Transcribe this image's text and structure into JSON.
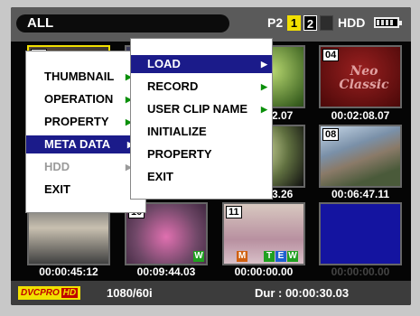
{
  "top_bar": {
    "selection": "ALL",
    "card_label": "P2",
    "slots": [
      "1",
      "2",
      ""
    ],
    "hdd_label": "HDD",
    "battery_level": 0.8
  },
  "clips": [
    {
      "number": "01",
      "timecode": ""
    },
    {
      "number": "",
      "timecode": ""
    },
    {
      "number": "",
      "timecode": "00:00:12.07"
    },
    {
      "number": "04",
      "timecode": "00:02:08.07",
      "thumb_text": "Neo Classic"
    },
    {
      "number": "",
      "timecode": ""
    },
    {
      "number": "",
      "timecode": ""
    },
    {
      "number": "",
      "timecode": "00:00:13.26"
    },
    {
      "number": "08",
      "timecode": "00:06:47.11"
    },
    {
      "number": "",
      "timecode": "00:00:45:12"
    },
    {
      "number": "10",
      "timecode": "00:09:44.03",
      "badges": [
        "W"
      ]
    },
    {
      "number": "11",
      "timecode": "00:00:00.00",
      "badges": [
        "M",
        "T",
        "E",
        "W"
      ]
    },
    {
      "number": "",
      "timecode": "00:00:00.00"
    }
  ],
  "bottom_bar": {
    "codec_part1": "DVCPRO",
    "codec_part2": "HD",
    "format": "1080/60i",
    "duration": "Dur : 00:00:30.03"
  },
  "main_menu": {
    "items": [
      {
        "label": "THUMBNAIL",
        "arrow": "▶"
      },
      {
        "label": "OPERATION",
        "arrow": "▶"
      },
      {
        "label": "PROPERTY",
        "arrow": "▶"
      },
      {
        "label": "META DATA",
        "arrow": "▶"
      },
      {
        "label": "HDD",
        "arrow": "▶"
      },
      {
        "label": "EXIT",
        "arrow": ""
      }
    ],
    "selected": "META DATA",
    "disabled": "HDD"
  },
  "sub_menu": {
    "items": [
      {
        "label": "LOAD",
        "arrow": "▶"
      },
      {
        "label": "RECORD",
        "arrow": "▶"
      },
      {
        "label": "USER CLIP NAME",
        "arrow": "▶"
      },
      {
        "label": "INITIALIZE",
        "arrow": ""
      },
      {
        "label": "PROPERTY",
        "arrow": ""
      },
      {
        "label": "EXIT",
        "arrow": ""
      }
    ],
    "selected": "LOAD"
  },
  "colors": {
    "selection_highlight": "#1b1b8a",
    "arrow_green": "#0a8f0a",
    "slot_yellow": "#f2e000"
  }
}
